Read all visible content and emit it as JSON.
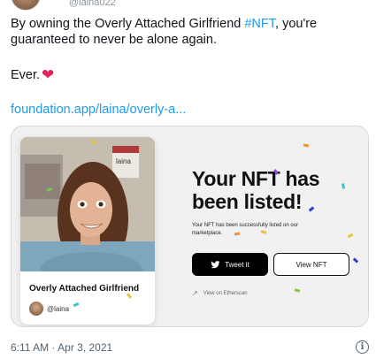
{
  "author": {
    "handle_partial": "@laina022"
  },
  "tweet": {
    "text_part1": "By owning the Overly Attached Girlfriend ",
    "hashtag": "#NFT",
    "text_part2": ", you're",
    "line2": "guaranteed to never be alone again.",
    "ever": "Ever.",
    "link": "foundation.app/laina/overly-a..."
  },
  "card": {
    "nft_title": "Overly Attached Girlfriend",
    "nft_user": "@laina",
    "headline": "Your NFT has been listed!",
    "subtext": "Your NFT has been successfully listed on our marketplace.",
    "tweet_button": "Tweet it",
    "view_button": "View NFT",
    "etherscan": "View on Etherscan",
    "image_sign": "laina"
  },
  "footer": {
    "timestamp": "6:11 AM · Apr 3, 2021"
  },
  "icons": [
    "heart-icon",
    "bird-icon",
    "external-link-icon",
    "info-icon"
  ],
  "colors": {
    "link": "#1d9bf0",
    "heart": "#e0245e",
    "text": "#0f1419",
    "muted": "#536471"
  }
}
